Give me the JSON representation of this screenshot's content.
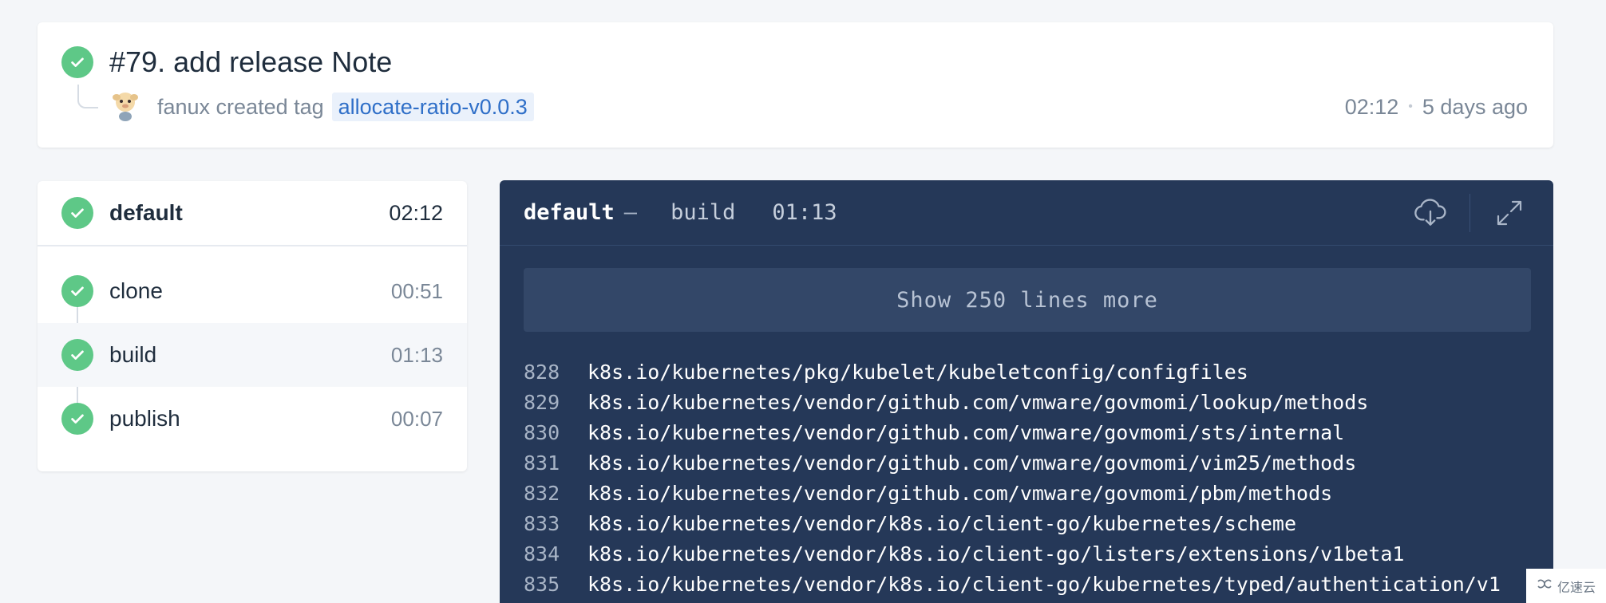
{
  "build": {
    "title": "#79. add release Note",
    "author_text": "fanux created tag",
    "tag": "allocate-ratio-v0.0.3",
    "duration": "02:12",
    "dot": "•",
    "age": "5 days ago",
    "status_color": "#5ec887"
  },
  "stage": {
    "name": "default",
    "time": "02:12",
    "steps": [
      {
        "name": "clone",
        "time": "00:51"
      },
      {
        "name": "build",
        "time": "01:13"
      },
      {
        "name": "publish",
        "time": "00:07"
      }
    ]
  },
  "log": {
    "stage": "default",
    "separator": "—",
    "step": "build",
    "duration": "01:13",
    "show_more": "Show 250 lines more",
    "lines": [
      {
        "num": "828",
        "text": "k8s.io/kubernetes/pkg/kubelet/kubeletconfig/configfiles"
      },
      {
        "num": "829",
        "text": "k8s.io/kubernetes/vendor/github.com/vmware/govmomi/lookup/methods"
      },
      {
        "num": "830",
        "text": "k8s.io/kubernetes/vendor/github.com/vmware/govmomi/sts/internal"
      },
      {
        "num": "831",
        "text": "k8s.io/kubernetes/vendor/github.com/vmware/govmomi/vim25/methods"
      },
      {
        "num": "832",
        "text": "k8s.io/kubernetes/vendor/github.com/vmware/govmomi/pbm/methods"
      },
      {
        "num": "833",
        "text": "k8s.io/kubernetes/vendor/k8s.io/client-go/kubernetes/scheme"
      },
      {
        "num": "834",
        "text": "k8s.io/kubernetes/vendor/k8s.io/client-go/listers/extensions/v1beta1"
      },
      {
        "num": "835",
        "text": "k8s.io/kubernetes/vendor/k8s.io/client-go/kubernetes/typed/authentication/v1"
      }
    ]
  },
  "watermark": {
    "text": "亿速云"
  },
  "icons": [
    "check-icon",
    "download-cloud-icon",
    "expand-icon",
    "avatar"
  ]
}
